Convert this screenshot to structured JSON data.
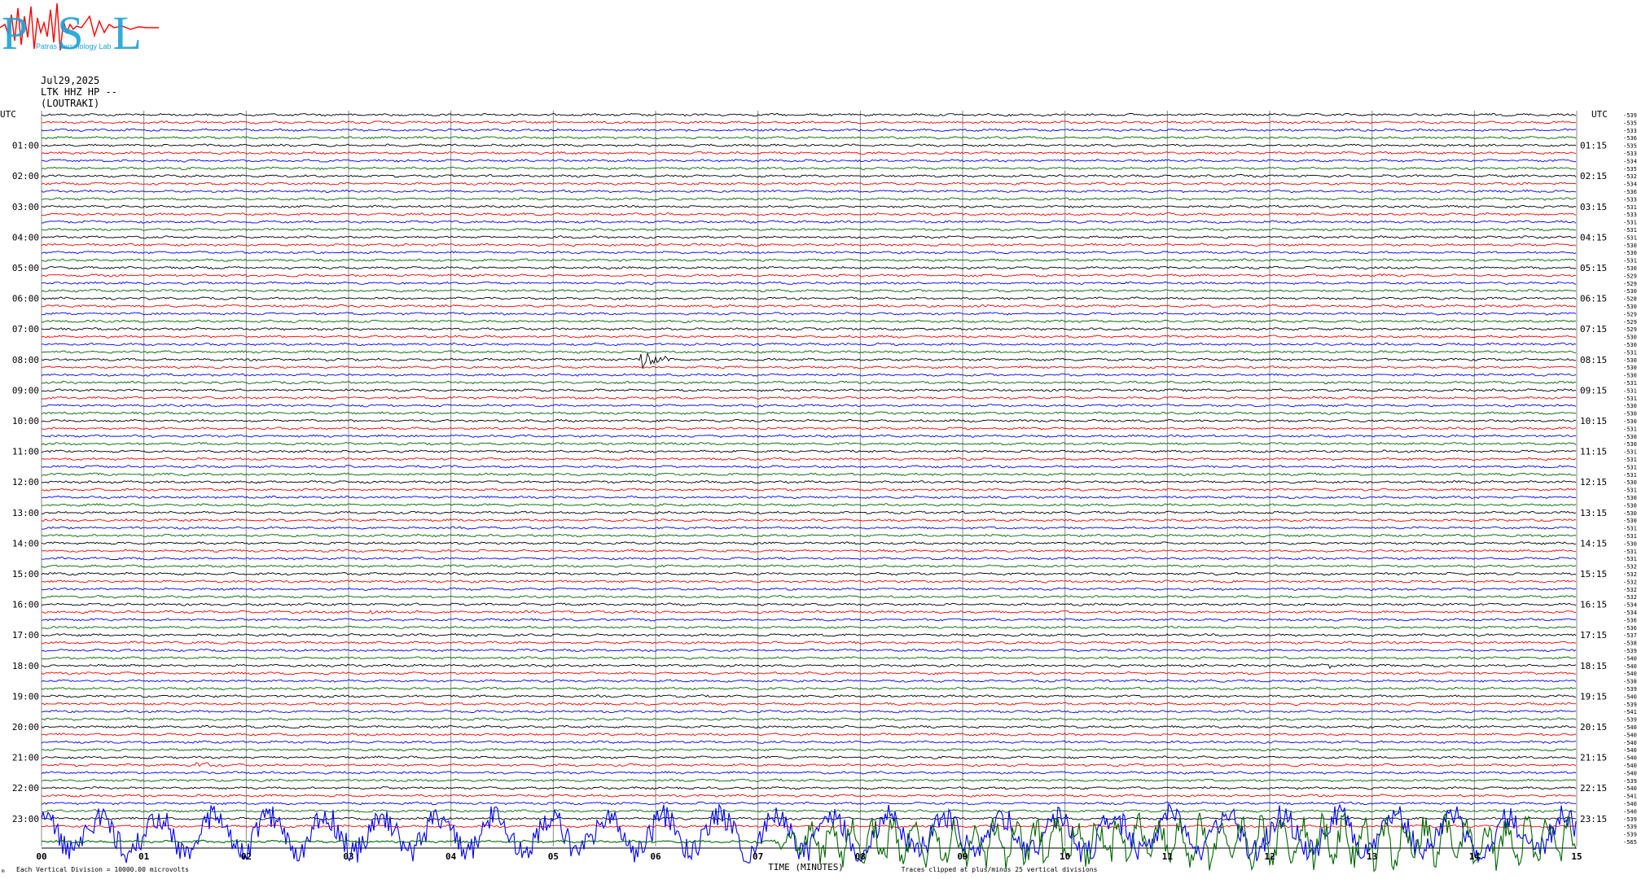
{
  "header": {
    "logo_text": "PSL",
    "logo_subtext": "Patras Seismology Lab",
    "date": "Jul29,2025",
    "channel": "LTK HHZ HP --",
    "location": "(LOUTRAKI)"
  },
  "colors": {
    "trace_cycle": [
      "#000000",
      "#ff0000",
      "#0000ff",
      "#006600"
    ],
    "grid": "#888888",
    "logo_red": "#ff0000",
    "logo_cyan": "#1aa3d6"
  },
  "chart_data": {
    "type": "line",
    "title": "",
    "xlabel": "TIME (MINUTES)",
    "ylabel": "UTC",
    "right_axis_label": "UTC",
    "xlim": [
      0,
      15
    ],
    "x_ticks": [
      "00",
      "01",
      "02",
      "03",
      "04",
      "05",
      "06",
      "07",
      "08",
      "09",
      "10",
      "11",
      "12",
      "13",
      "14",
      "15"
    ],
    "left_hour_labels": [
      "01:00",
      "02:00",
      "03:00",
      "04:00",
      "05:00",
      "06:00",
      "07:00",
      "08:00",
      "09:00",
      "10:00",
      "11:00",
      "12:00",
      "13:00",
      "14:00",
      "15:00",
      "16:00",
      "17:00",
      "18:00",
      "19:00",
      "20:00",
      "21:00",
      "22:00",
      "23:00"
    ],
    "right_hour_labels": [
      "01:15",
      "02:15",
      "03:15",
      "04:15",
      "05:15",
      "06:15",
      "07:15",
      "08:15",
      "09:15",
      "10:15",
      "11:15",
      "12:15",
      "13:15",
      "14:15",
      "15:15",
      "16:15",
      "17:15",
      "18:15",
      "19:15",
      "20:15",
      "21:15",
      "22:15",
      "23:15"
    ],
    "trace_count": 96,
    "traces_per_hour": 4,
    "minutes_per_trace": 15,
    "trace_offsets": [
      "-5391",
      "-5351",
      "-5335",
      "-5365",
      "-5356",
      "-5334",
      "-5349",
      "-5352",
      "-5329",
      "-5343",
      "-5365",
      "-5331",
      "-5316",
      "-5333",
      "-5315",
      "-5314",
      "-5318",
      "-5308",
      "-5306",
      "-5311",
      "-5306",
      "-5294",
      "-5292",
      "-5302",
      "-5287",
      "-5303",
      "-5293",
      "-5292",
      "-5290",
      "-5303",
      "-5304",
      "-5311",
      "-5306",
      "-5306",
      "-5303",
      "-5316",
      "-5314",
      "-5317",
      "-5306",
      "-5309",
      "-5308",
      "-5312",
      "-5301",
      "-5309",
      "-5316",
      "-5311",
      "-5310",
      "-5316",
      "-5307",
      "-5312",
      "-5301",
      "-5309",
      "-5304",
      "-5303",
      "-5316",
      "-5311",
      "-5308",
      "-5313",
      "-5311",
      "-5321",
      "-5322",
      "-5327",
      "-5325",
      "-5320",
      "-5348",
      "-5349",
      "-5365",
      "-5366",
      "-5376",
      "-5389",
      "-5393",
      "-5403",
      "-5404",
      "-5408",
      "-5386",
      "-5397",
      "-5401",
      "-5398",
      "-5415",
      "-5399",
      "-5408",
      "-5403",
      "-5401",
      "-5404",
      "-5404",
      "-5404",
      "-5407",
      "-5398",
      "-5402",
      "-5414",
      "-5401",
      "-5404",
      "-5398",
      "-5396",
      "-5395",
      "-5654"
    ],
    "events": [
      {
        "trace_index": 32,
        "minute": 5.85,
        "amplitude": "large"
      },
      {
        "trace_index": 85,
        "minute": 1.5,
        "amplitude": "small"
      },
      {
        "trace_index": 65,
        "minute": 3.2,
        "amplitude": "small"
      },
      {
        "trace_index": 72,
        "minute": 12.5,
        "amplitude": "small"
      }
    ],
    "clipped_traces": [
      {
        "trace_index": 94,
        "start_minute": 0.0,
        "color": "#006600"
      },
      {
        "trace_index": 95,
        "start_minute": 7.1,
        "color": "#0000ff"
      }
    ],
    "grid": true
  },
  "footer": {
    "scale_note": "Each Vertical Division = 10000.00 microvolts",
    "clip_note": "Traces clipped at plus/minus 25 vertical divisions",
    "small_mark": "m"
  }
}
